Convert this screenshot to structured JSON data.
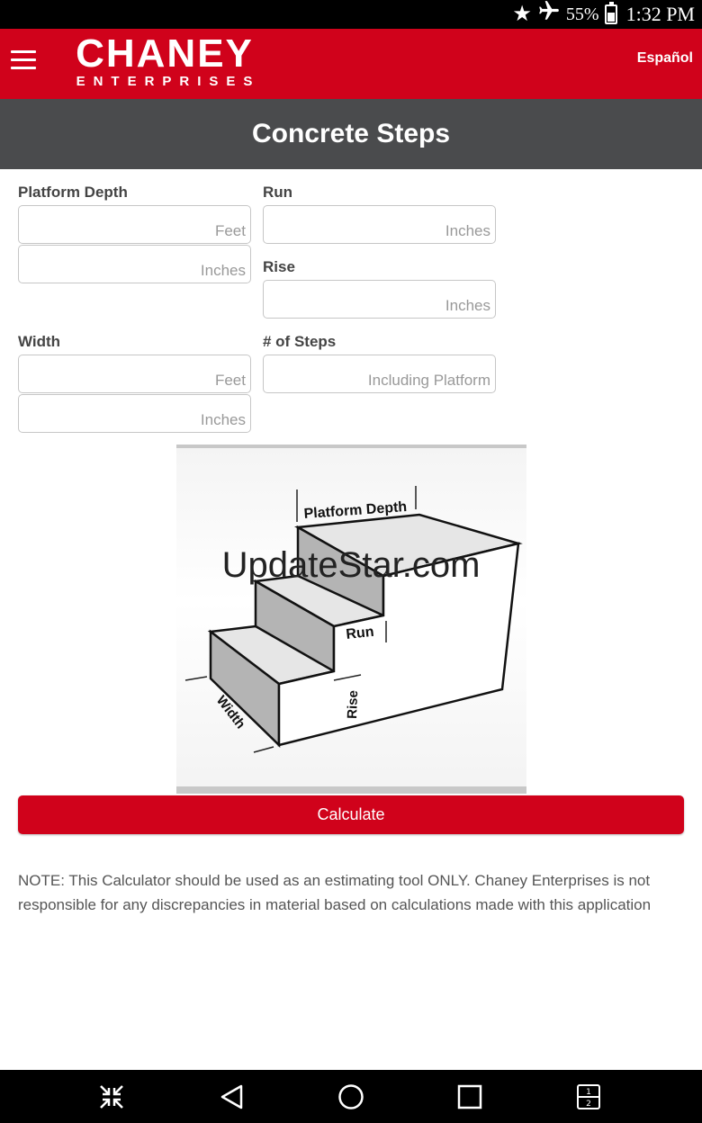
{
  "status_bar": {
    "battery": "55%",
    "battery_level": 0.55,
    "time": "1:32 PM",
    "icons": [
      "star-icon",
      "airplane-mode-icon",
      "battery-icon"
    ]
  },
  "header": {
    "logo_main": "CHANEY",
    "logo_sub": "ENTERPRISES",
    "language_link": "Español",
    "menu_icon": "hamburger-menu-icon"
  },
  "page_title": "Concrete Steps",
  "form": {
    "platform_depth": {
      "label": "Platform Depth",
      "feet_placeholder": "Feet",
      "inches_placeholder": "Inches"
    },
    "run": {
      "label": "Run",
      "placeholder": "Inches"
    },
    "rise": {
      "label": "Rise",
      "placeholder": "Inches"
    },
    "width": {
      "label": "Width",
      "feet_placeholder": "Feet",
      "inches_placeholder": "Inches"
    },
    "steps": {
      "label": "# of Steps",
      "placeholder": "Including Platform"
    }
  },
  "diagram": {
    "labels": {
      "platform_depth": "Platform Depth",
      "run": "Run",
      "rise": "Rise",
      "width": "Width"
    }
  },
  "watermark": "UpdateStar.com",
  "calculate_button": "Calculate",
  "note": "NOTE: This Calculator should be used as an estimating tool ONLY. Chaney Enterprises is not responsible for any discrepancies in material based on calculations made with this application",
  "nav_bar": {
    "icons": [
      "collapse-icon",
      "back-icon",
      "home-icon",
      "recents-icon",
      "split-screen-icon"
    ]
  },
  "colors": {
    "brand_red": "#d0021b",
    "title_gray": "#4a4b4d"
  }
}
